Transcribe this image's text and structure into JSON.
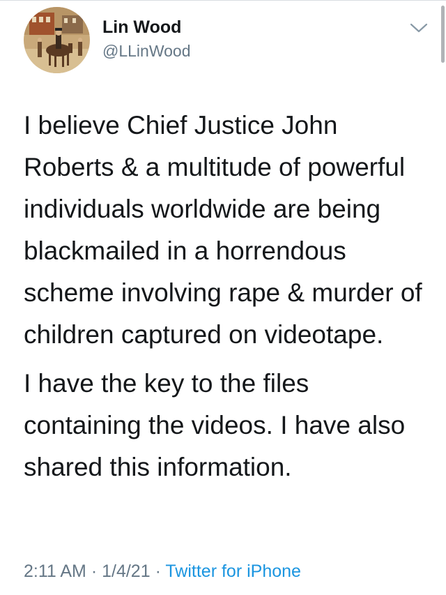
{
  "tweet": {
    "author": {
      "display_name": "Lin Wood",
      "handle": "@LLinWood",
      "avatar_icon": "profile-photo-horse-rider-painting"
    },
    "menu_icon": "chevron-down-icon",
    "paragraphs": [
      "I believe Chief Justice John Roberts & a multitude of powerful individuals worldwide are being blackmailed in a horrendous scheme involving rape & murder of children captured on videotape.",
      "I have the key to the files containing the videos. I have also shared this information."
    ],
    "time": "2:11 AM",
    "separator": "·",
    "date": "1/4/21",
    "source": "Twitter for iPhone"
  },
  "colors": {
    "text": "#14171a",
    "muted": "#657786",
    "link": "#1b95e0",
    "background": "#ffffff"
  }
}
